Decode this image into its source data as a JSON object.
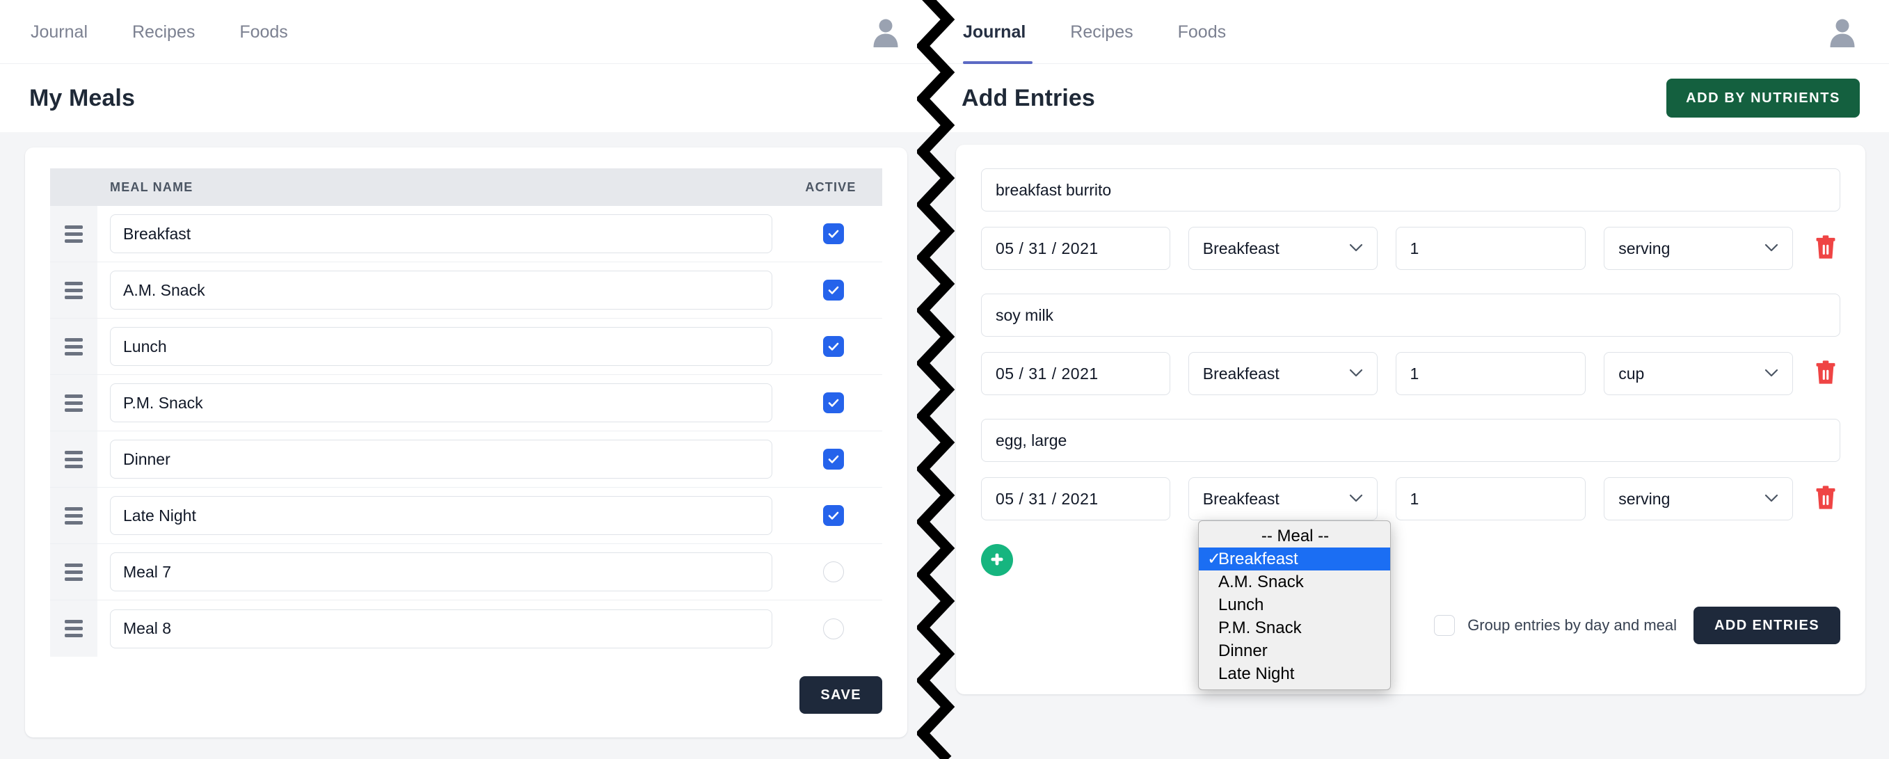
{
  "left": {
    "nav": [
      {
        "label": "Journal",
        "active": false
      },
      {
        "label": "Recipes",
        "active": false
      },
      {
        "label": "Foods",
        "active": false
      }
    ],
    "page_title": "My Meals",
    "table": {
      "col_name": "MEAL NAME",
      "col_active": "ACTIVE",
      "rows": [
        {
          "name": "Breakfast",
          "active": true
        },
        {
          "name": "A.M. Snack",
          "active": true
        },
        {
          "name": "Lunch",
          "active": true
        },
        {
          "name": "P.M. Snack",
          "active": true
        },
        {
          "name": "Dinner",
          "active": true
        },
        {
          "name": "Late Night",
          "active": true
        },
        {
          "name": "Meal 7",
          "active": false
        },
        {
          "name": "Meal 8",
          "active": false
        }
      ]
    },
    "save_label": "SAVE"
  },
  "right": {
    "nav": [
      {
        "label": "Journal",
        "active": true
      },
      {
        "label": "Recipes",
        "active": false
      },
      {
        "label": "Foods",
        "active": false
      }
    ],
    "page_title": "Add Entries",
    "add_by_nutrients_label": "ADD BY NUTRIENTS",
    "entries": [
      {
        "food": "breakfast burrito",
        "date": "05 / 31 / 2021",
        "meal": "Breakfeast",
        "qty": "1",
        "unit": "serving"
      },
      {
        "food": "soy milk",
        "date": "05 / 31 / 2021",
        "meal": "Breakfeast",
        "qty": "1",
        "unit": "cup"
      },
      {
        "food": "egg, large",
        "date": "05 / 31 / 2021",
        "meal": "Breakfeast",
        "qty": "1",
        "unit": "serving"
      }
    ],
    "group_label": "Group entries by day and meal",
    "group_checked": false,
    "add_entries_label": "ADD ENTRIES",
    "meal_dropdown": {
      "open": true,
      "selected": "Breakfeast",
      "options": [
        "-- Meal --",
        "Breakfeast",
        "A.M. Snack",
        "Lunch",
        "P.M. Snack",
        "Dinner",
        "Late Night"
      ]
    }
  },
  "icons": {
    "avatar": "user-avatar-icon",
    "grip": "drag-handle-icon",
    "trash": "trash-icon",
    "plus": "plus-icon",
    "chevron": "chevron-down-icon"
  },
  "colors": {
    "accent_blue": "#2563eb",
    "tab_underline": "#5c6ac4",
    "green_button": "#14603f",
    "green_add": "#16b57f",
    "dark_button": "#1e293b",
    "trash_red": "#ef4444",
    "select_highlight": "#1b6ef3"
  }
}
